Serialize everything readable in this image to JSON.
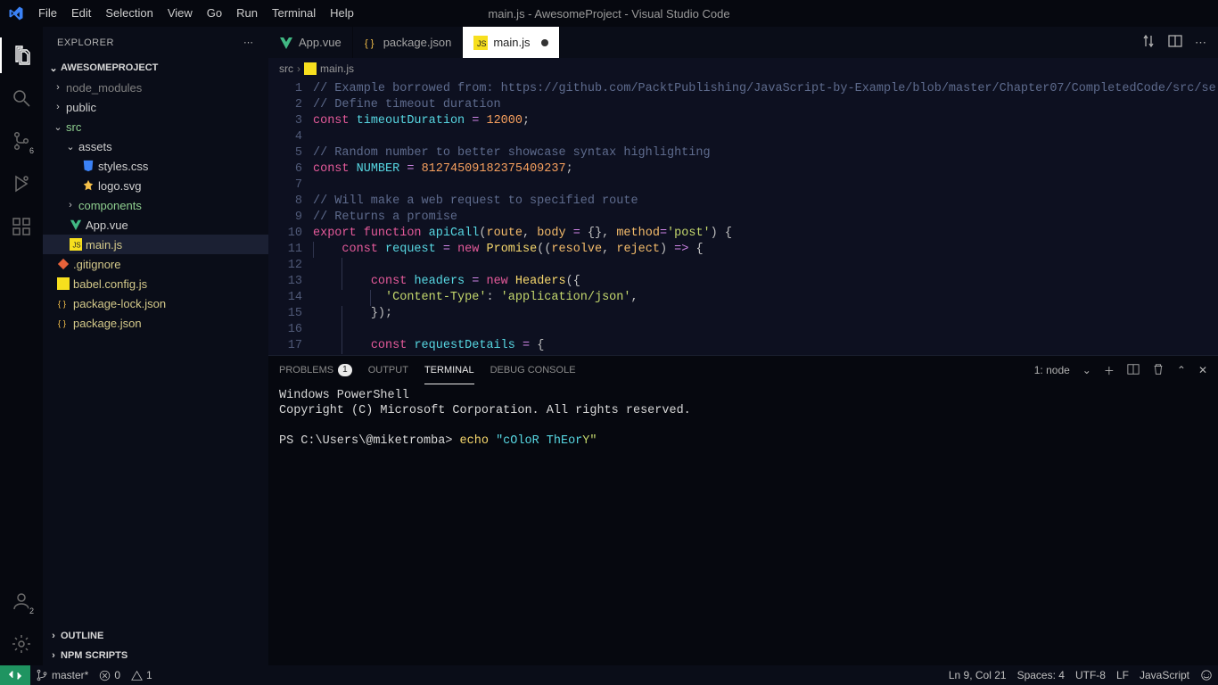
{
  "window": {
    "title": "main.js - AwesomeProject - Visual Studio Code"
  },
  "menu": {
    "file": "File",
    "edit": "Edit",
    "selection": "Selection",
    "view": "View",
    "go": "Go",
    "run": "Run",
    "terminal": "Terminal",
    "help": "Help"
  },
  "activity": {
    "scm_badge": "6",
    "acct_badge": "2"
  },
  "sidebar": {
    "title": "EXPLORER",
    "project": "AWESOMEPROJECT",
    "outline": "OUTLINE",
    "npm": "NPM SCRIPTS",
    "tree": {
      "node_modules": "node_modules",
      "public": "public",
      "src": "src",
      "assets": "assets",
      "styles": "styles.css",
      "logo": "logo.svg",
      "components": "components",
      "appvue": "App.vue",
      "mainjs": "main.js",
      "gitignore": ".gitignore",
      "babel": "babel.config.js",
      "pkglock": "package-lock.json",
      "pkg": "package.json"
    }
  },
  "tabs": {
    "appvue": "App.vue",
    "pkgjson": "package.json",
    "mainjs": "main.js"
  },
  "breadcrumbs": {
    "src": "src",
    "mainjs": "main.js"
  },
  "code": {
    "lines": [
      1,
      2,
      3,
      4,
      5,
      6,
      7,
      8,
      9,
      10,
      11,
      12,
      13,
      14,
      15,
      16,
      17
    ],
    "l1": "// Example borrowed from: https://github.com/PacktPublishing/JavaScript-by-Example/blob/master/Chapter07/CompletedCode/src/se",
    "l2": "// Define timeout duration",
    "l3_kw": "const",
    "l3_var": "timeoutDuration",
    "l3_eq": "=",
    "l3_num": "12000",
    "l3_sc": ";",
    "l5": "// Random number to better showcase syntax highlighting",
    "l6_kw": "const",
    "l6_var": "NUMBER",
    "l6_eq": "=",
    "l6_num": "81274509182375409237",
    "l6_sc": ";",
    "l8": "// Will make a web request to specified route",
    "l9": "// Returns a promise",
    "l10_export": "export",
    "l10_func": "function",
    "l10_name": "apiCall",
    "l10_p1": "route",
    "l10_p2": "body",
    "l10_eq": "=",
    "l10_empty": "{}",
    "l10_p3": "method",
    "l10_str": "'post'",
    "l10_end": ") {",
    "l11_const": "const",
    "l11_req": "request",
    "l11_eq": "=",
    "l11_new": "new",
    "l11_prom": "Promise",
    "l11_op": "((",
    "l11_res": "resolve",
    "l11_rej": "reject",
    "l11_arrow": "=>",
    "l11_end": "{",
    "l13_const": "const",
    "l13_head": "headers",
    "l13_eq": "=",
    "l13_new": "new",
    "l13_headers": "Headers",
    "l13_open": "({",
    "l14_key": "'Content-Type'",
    "l14_colon": ":",
    "l14_val": "'application/json'",
    "l14_comma": ",",
    "l15_close": "});",
    "l17_const": "const",
    "l17_rd": "requestDetails",
    "l17_eq": "=",
    "l17_open": "{"
  },
  "panel": {
    "tabs": {
      "problems": "PROBLEMS",
      "problems_badge": "1",
      "output": "OUTPUT",
      "terminal": "TERMINAL",
      "debug": "DEBUG CONSOLE"
    },
    "terminal_label": "1: node",
    "term_l1": "Windows PowerShell",
    "term_l2": "Copyright (C) Microsoft Corporation. All rights reserved.",
    "term_prompt": "PS C:\\Users\\@miketromba> ",
    "term_cmd": "echo ",
    "term_str1": "\"cOloR ThEor",
    "term_str2": "Y\""
  },
  "status": {
    "branch": "master*",
    "errors": "0",
    "warnings": "1",
    "position": "Ln 9, Col 21",
    "spaces": "Spaces: 4",
    "encoding": "UTF-8",
    "eol": "LF",
    "lang": "JavaScript"
  }
}
